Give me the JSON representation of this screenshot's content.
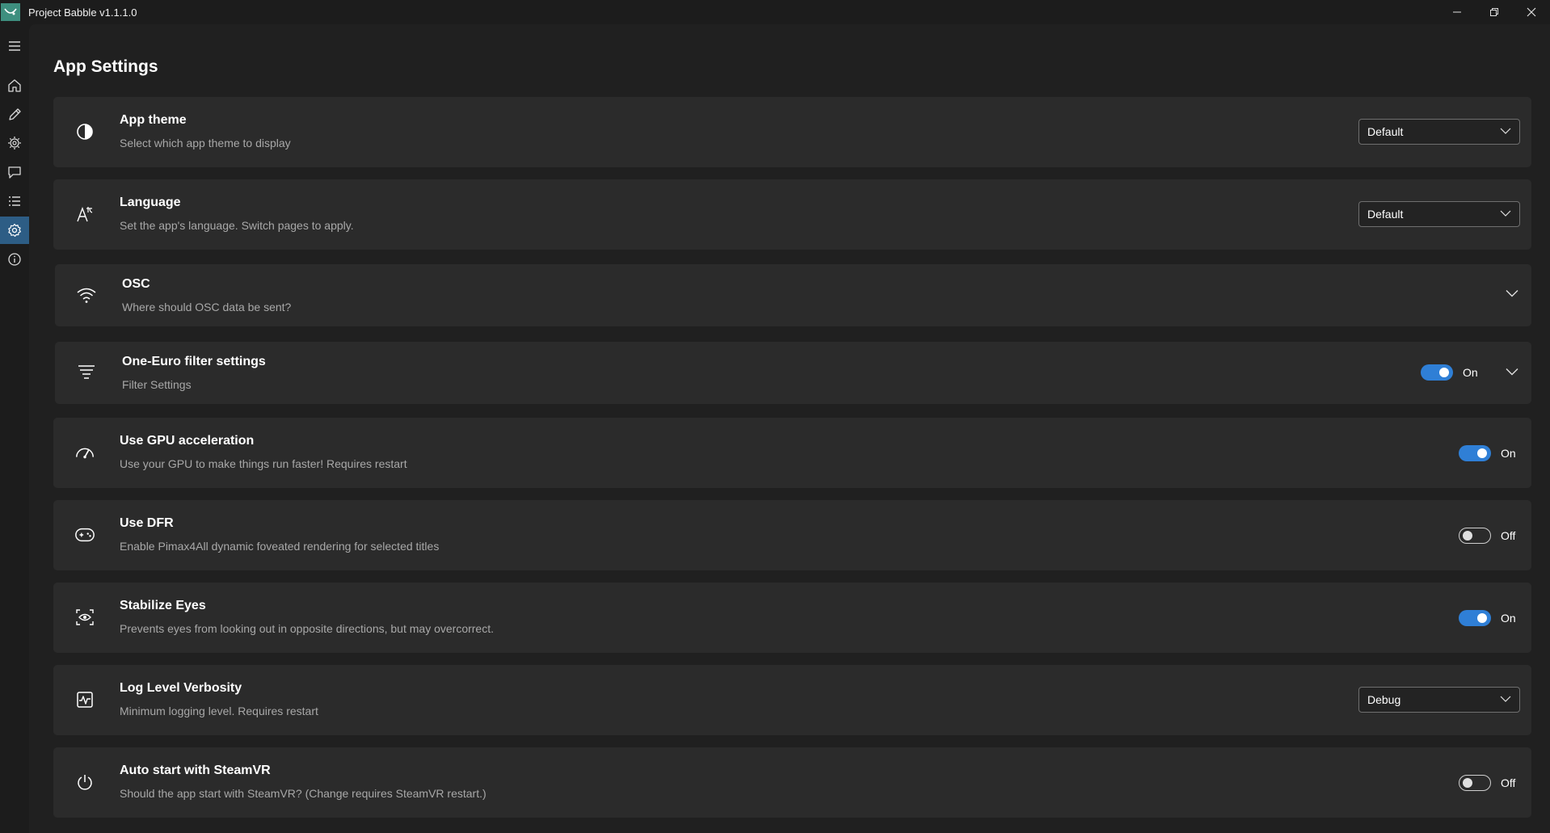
{
  "window": {
    "title": "Project Babble v1.1.1.0"
  },
  "page": {
    "title": "App Settings"
  },
  "sidebar": {
    "items": [
      {
        "icon": "menu-icon"
      },
      {
        "icon": "home-icon"
      },
      {
        "icon": "pencil-icon"
      },
      {
        "icon": "gear-chip-icon"
      },
      {
        "icon": "chat-icon"
      },
      {
        "icon": "list-icon"
      },
      {
        "icon": "settings-icon",
        "active": true
      },
      {
        "icon": "info-icon"
      }
    ]
  },
  "settings": {
    "app_theme": {
      "title": "App theme",
      "desc": "Select which app theme to display",
      "value": "Default"
    },
    "language": {
      "title": "Language",
      "desc": "Set the app's language. Switch pages to apply.",
      "value": "Default"
    },
    "osc": {
      "title": "OSC",
      "desc": "Where should OSC data be sent?"
    },
    "one_euro": {
      "title": "One-Euro filter settings",
      "desc": "Filter Settings",
      "state": "On"
    },
    "gpu": {
      "title": "Use GPU acceleration",
      "desc": "Use your GPU to make things run faster! Requires restart",
      "state": "On"
    },
    "dfr": {
      "title": "Use DFR",
      "desc": "Enable Pimax4All dynamic foveated rendering for selected titles",
      "state": "Off"
    },
    "stabilize": {
      "title": "Stabilize Eyes",
      "desc": "Prevents eyes from looking out in opposite directions, but may overcorrect.",
      "state": "On"
    },
    "log_level": {
      "title": "Log Level Verbosity",
      "desc": "Minimum logging level. Requires restart",
      "value": "Debug"
    },
    "autostart": {
      "title": "Auto start with SteamVR",
      "desc": "Should the app start with SteamVR? (Change requires SteamVR restart.)",
      "state": "Off"
    }
  },
  "colors": {
    "accent": "#2f7fd6",
    "active_nav": "#2d5d85",
    "card": "#2b2b2b",
    "background": "#202020"
  }
}
